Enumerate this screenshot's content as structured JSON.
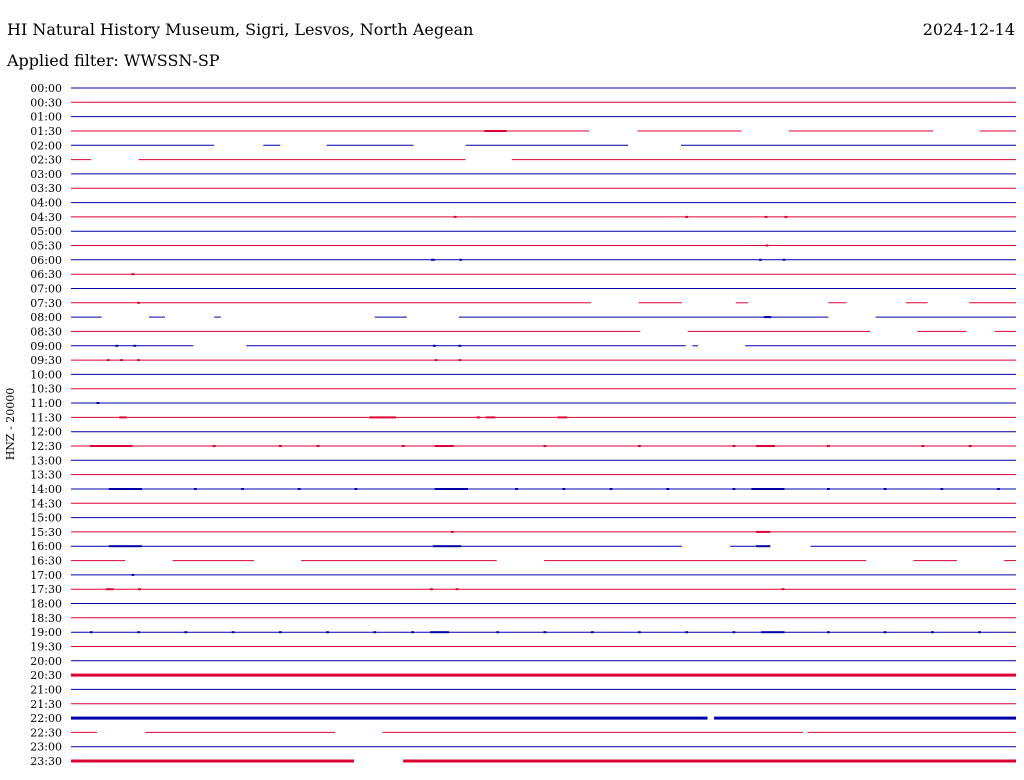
{
  "header": {
    "title": "HI Natural History Museum, Sigri, Lesvos, North Aegean",
    "date": "2024-12-14",
    "filter": "Applied filter: WWSSN-SP"
  },
  "colors": {
    "even_row": "#0000aa",
    "odd_row": "#dd0033",
    "background": "#ffffff",
    "text": "#000000"
  },
  "chart_data": {
    "type": "line",
    "title": "HI Natural History Museum, Sigri, Lesvos, North Aegean",
    "ylabel": "HNZ - 20000",
    "xlabel": "",
    "rows": [
      {
        "label": "00:00",
        "segments": [
          [
            0,
            1
          ]
        ],
        "bursts": []
      },
      {
        "label": "00:30",
        "segments": [
          [
            0,
            1
          ]
        ],
        "bursts": []
      },
      {
        "label": "01:00",
        "segments": [
          [
            0,
            1
          ]
        ],
        "bursts": []
      },
      {
        "label": "01:30",
        "segments": [
          [
            0,
            0.5485
          ],
          [
            0.5995,
            0.7095
          ],
          [
            0.7595,
            0.9125
          ],
          [
            0.9615,
            1
          ]
        ],
        "bursts": [
          [
            0.4375,
            0.0235,
            2
          ]
        ]
      },
      {
        "label": "02:00",
        "segments": [
          [
            0,
            0.1515
          ],
          [
            0.2035,
            0.2215
          ],
          [
            0.2705,
            0.3625
          ],
          [
            0.4175,
            0.5895
          ],
          [
            0.6455,
            1
          ]
        ],
        "bursts": []
      },
      {
        "label": "02:30",
        "segments": [
          [
            0,
            0.0215
          ],
          [
            0.0715,
            0.4175
          ],
          [
            0.4665,
            1
          ]
        ],
        "bursts": []
      },
      {
        "label": "03:00",
        "segments": [
          [
            0,
            1
          ]
        ],
        "bursts": []
      },
      {
        "label": "03:30",
        "segments": [
          [
            0,
            1
          ]
        ],
        "bursts": []
      },
      {
        "label": "04:00",
        "segments": [
          [
            0,
            1
          ]
        ],
        "bursts": []
      },
      {
        "label": "04:30",
        "segments": [
          [
            0,
            1
          ]
        ],
        "bursts": [
          [
            0.405,
            0.003,
            2
          ],
          [
            0.65,
            0.003,
            2
          ],
          [
            0.734,
            0.003,
            2
          ],
          [
            0.755,
            0.003,
            2
          ]
        ]
      },
      {
        "label": "05:00",
        "segments": [
          [
            0,
            1
          ]
        ],
        "bursts": []
      },
      {
        "label": "05:30",
        "segments": [
          [
            0,
            1
          ]
        ],
        "bursts": [
          [
            0.735,
            0.003,
            2
          ]
        ]
      },
      {
        "label": "06:00",
        "segments": [
          [
            0,
            1
          ]
        ],
        "bursts": [
          [
            0.381,
            0.004,
            2
          ],
          [
            0.411,
            0.003,
            2
          ],
          [
            0.728,
            0.003,
            2
          ],
          [
            0.753,
            0.003,
            2
          ]
        ]
      },
      {
        "label": "06:30",
        "segments": [
          [
            0,
            1
          ]
        ],
        "bursts": [
          [
            0.064,
            0.003,
            2
          ]
        ]
      },
      {
        "label": "07:00",
        "segments": [
          [
            0,
            1
          ]
        ],
        "bursts": []
      },
      {
        "label": "07:30",
        "segments": [
          [
            0,
            0.5505
          ],
          [
            0.6005,
            0.6465
          ],
          [
            0.7035,
            0.7165
          ],
          [
            0.8015,
            0.8205
          ],
          [
            0.8835,
            0.9065
          ],
          [
            0.9505,
            1
          ]
        ],
        "bursts": [
          [
            0.07,
            0.003,
            2
          ]
        ]
      },
      {
        "label": "08:00",
        "segments": [
          [
            0,
            0.0325
          ],
          [
            0.0825,
            0.0995
          ],
          [
            0.1515,
            0.1585
          ],
          [
            0.3215,
            0.3555
          ],
          [
            0.4105,
            0.8015
          ],
          [
            0.8515,
            1
          ]
        ],
        "bursts": [
          [
            0.733,
            0.008,
            2
          ]
        ]
      },
      {
        "label": "08:30",
        "segments": [
          [
            0,
            0.6025
          ],
          [
            0.6525,
            0.8455
          ],
          [
            0.8955,
            0.9475
          ],
          [
            0.9775,
            1
          ]
        ],
        "bursts": []
      },
      {
        "label": "09:00",
        "segments": [
          [
            0,
            0.1295
          ],
          [
            0.1855,
            0.6505
          ],
          [
            0.6575,
            0.6635
          ],
          [
            0.7135,
            1
          ]
        ],
        "bursts": [
          [
            0.047,
            0.003,
            2
          ],
          [
            0.066,
            0.003,
            2
          ],
          [
            0.383,
            0.003,
            2
          ],
          [
            0.41,
            0.003,
            2
          ]
        ]
      },
      {
        "label": "09:30",
        "segments": [
          [
            0,
            1
          ]
        ],
        "bursts": [
          [
            0.038,
            0.003,
            2
          ],
          [
            0.052,
            0.003,
            2
          ],
          [
            0.07,
            0.003,
            2
          ],
          [
            0.385,
            0.003,
            2
          ],
          [
            0.41,
            0.003,
            2
          ]
        ]
      },
      {
        "label": "10:00",
        "segments": [
          [
            0,
            1
          ]
        ],
        "bursts": []
      },
      {
        "label": "10:30",
        "segments": [
          [
            0,
            1
          ]
        ],
        "bursts": []
      },
      {
        "label": "11:00",
        "segments": [
          [
            0,
            1
          ]
        ],
        "bursts": [
          [
            0.027,
            0.003,
            2
          ]
        ]
      },
      {
        "label": "11:30",
        "segments": [
          [
            0,
            1
          ]
        ],
        "bursts": [
          [
            0.051,
            0.008,
            2
          ],
          [
            0.316,
            0.028,
            2
          ],
          [
            0.429,
            0.004,
            2
          ],
          [
            0.439,
            0.01,
            2
          ],
          [
            0.515,
            0.01,
            2
          ]
        ]
      },
      {
        "label": "12:00",
        "segments": [
          [
            0,
            1
          ]
        ],
        "bursts": []
      },
      {
        "label": "12:30",
        "segments": [
          [
            0,
            1
          ]
        ],
        "bursts": [
          [
            0.02,
            0.045,
            2
          ],
          [
            0.15,
            0.003,
            2
          ],
          [
            0.22,
            0.003,
            2
          ],
          [
            0.26,
            0.003,
            2
          ],
          [
            0.35,
            0.003,
            2
          ],
          [
            0.385,
            0.02,
            2
          ],
          [
            0.5,
            0.003,
            2
          ],
          [
            0.6,
            0.003,
            2
          ],
          [
            0.7,
            0.003,
            2
          ],
          [
            0.725,
            0.02,
            2
          ],
          [
            0.8,
            0.003,
            2
          ],
          [
            0.9,
            0.003,
            2
          ],
          [
            0.95,
            0.003,
            2
          ]
        ]
      },
      {
        "label": "13:00",
        "segments": [
          [
            0,
            1
          ]
        ],
        "bursts": []
      },
      {
        "label": "13:30",
        "segments": [
          [
            0,
            1
          ]
        ],
        "bursts": []
      },
      {
        "label": "14:00",
        "segments": [
          [
            0,
            1
          ]
        ],
        "bursts": [
          [
            0.04,
            0.035,
            2
          ],
          [
            0.13,
            0.003,
            2
          ],
          [
            0.18,
            0.003,
            2
          ],
          [
            0.24,
            0.003,
            2
          ],
          [
            0.3,
            0.003,
            2
          ],
          [
            0.385,
            0.035,
            2
          ],
          [
            0.47,
            0.003,
            2
          ],
          [
            0.52,
            0.003,
            2
          ],
          [
            0.57,
            0.003,
            2
          ],
          [
            0.63,
            0.003,
            2
          ],
          [
            0.7,
            0.003,
            2
          ],
          [
            0.72,
            0.035,
            2
          ],
          [
            0.8,
            0.003,
            2
          ],
          [
            0.86,
            0.003,
            2
          ],
          [
            0.92,
            0.003,
            2
          ],
          [
            0.98,
            0.003,
            2
          ]
        ]
      },
      {
        "label": "14:30",
        "segments": [
          [
            0,
            1
          ]
        ],
        "bursts": []
      },
      {
        "label": "15:00",
        "segments": [
          [
            0,
            1
          ]
        ],
        "bursts": []
      },
      {
        "label": "15:30",
        "segments": [
          [
            0,
            1
          ]
        ],
        "bursts": [
          [
            0.402,
            0.003,
            2
          ],
          [
            0.725,
            0.015,
            2
          ]
        ]
      },
      {
        "label": "16:00",
        "segments": [
          [
            0,
            0.6465
          ],
          [
            0.6975,
            0.7355
          ],
          [
            0.7825,
            1
          ]
        ],
        "bursts": [
          [
            0.04,
            0.035,
            2
          ],
          [
            0.383,
            0.03,
            2
          ],
          [
            0.725,
            0.015,
            2
          ]
        ]
      },
      {
        "label": "16:30",
        "segments": [
          [
            0,
            0.0575
          ],
          [
            0.1075,
            0.1935
          ],
          [
            0.2435,
            0.4505
          ],
          [
            0.5005,
            0.8415
          ],
          [
            0.8915,
            0.9375
          ],
          [
            0.9875,
            1
          ]
        ],
        "bursts": []
      },
      {
        "label": "17:00",
        "segments": [
          [
            0,
            1
          ]
        ],
        "bursts": [
          [
            0.064,
            0.003,
            2
          ]
        ]
      },
      {
        "label": "17:30",
        "segments": [
          [
            0,
            1
          ]
        ],
        "bursts": [
          [
            0.037,
            0.008,
            2
          ],
          [
            0.071,
            0.003,
            2
          ],
          [
            0.38,
            0.003,
            2
          ],
          [
            0.407,
            0.003,
            2
          ],
          [
            0.752,
            0.003,
            2
          ]
        ]
      },
      {
        "label": "18:00",
        "segments": [
          [
            0,
            1
          ]
        ],
        "bursts": []
      },
      {
        "label": "18:30",
        "segments": [
          [
            0,
            1
          ]
        ],
        "bursts": []
      },
      {
        "label": "19:00",
        "segments": [
          [
            0,
            1
          ]
        ],
        "bursts": [
          [
            0.02,
            0.003,
            2
          ],
          [
            0.07,
            0.003,
            2
          ],
          [
            0.12,
            0.003,
            2
          ],
          [
            0.17,
            0.003,
            2
          ],
          [
            0.22,
            0.003,
            2
          ],
          [
            0.27,
            0.003,
            2
          ],
          [
            0.32,
            0.003,
            2
          ],
          [
            0.36,
            0.003,
            2
          ],
          [
            0.38,
            0.02,
            2
          ],
          [
            0.45,
            0.003,
            2
          ],
          [
            0.5,
            0.003,
            2
          ],
          [
            0.55,
            0.003,
            2
          ],
          [
            0.6,
            0.003,
            2
          ],
          [
            0.65,
            0.003,
            2
          ],
          [
            0.7,
            0.003,
            2
          ],
          [
            0.73,
            0.025,
            2
          ],
          [
            0.8,
            0.003,
            2
          ],
          [
            0.86,
            0.003,
            2
          ],
          [
            0.91,
            0.003,
            2
          ],
          [
            0.96,
            0.003,
            2
          ]
        ]
      },
      {
        "label": "19:30",
        "segments": [
          [
            0,
            1
          ]
        ],
        "bursts": []
      },
      {
        "label": "20:00",
        "segments": [
          [
            0,
            1
          ]
        ],
        "bursts": []
      },
      {
        "label": "20:30",
        "segments": [
          [
            0,
            1
          ]
        ],
        "bursts": [
          [
            0,
            1,
            3
          ]
        ]
      },
      {
        "label": "21:00",
        "segments": [
          [
            0,
            1
          ]
        ],
        "bursts": []
      },
      {
        "label": "21:30",
        "segments": [
          [
            0,
            1
          ]
        ],
        "bursts": []
      },
      {
        "label": "22:00",
        "segments": [
          [
            0,
            0.6735
          ],
          [
            0.6805,
            1
          ]
        ],
        "bursts": [
          [
            0,
            0.6735,
            3
          ],
          [
            0.6805,
            0.3195,
            3
          ]
        ]
      },
      {
        "label": "22:30",
        "segments": [
          [
            0,
            0.0275
          ],
          [
            0.0785,
            0.2795
          ],
          [
            0.3295,
            0.7745
          ],
          [
            0.7795,
            1
          ]
        ],
        "bursts": []
      },
      {
        "label": "23:00",
        "segments": [
          [
            0,
            1
          ]
        ],
        "bursts": []
      },
      {
        "label": "23:30",
        "segments": [
          [
            0,
            0.2995
          ],
          [
            0.3515,
            1
          ]
        ],
        "bursts": [
          [
            0,
            0.2995,
            3
          ],
          [
            0.3515,
            0.6485,
            3
          ]
        ]
      }
    ],
    "ylim": [
      "00:00",
      "23:30"
    ],
    "grid": false,
    "legend": "none"
  }
}
